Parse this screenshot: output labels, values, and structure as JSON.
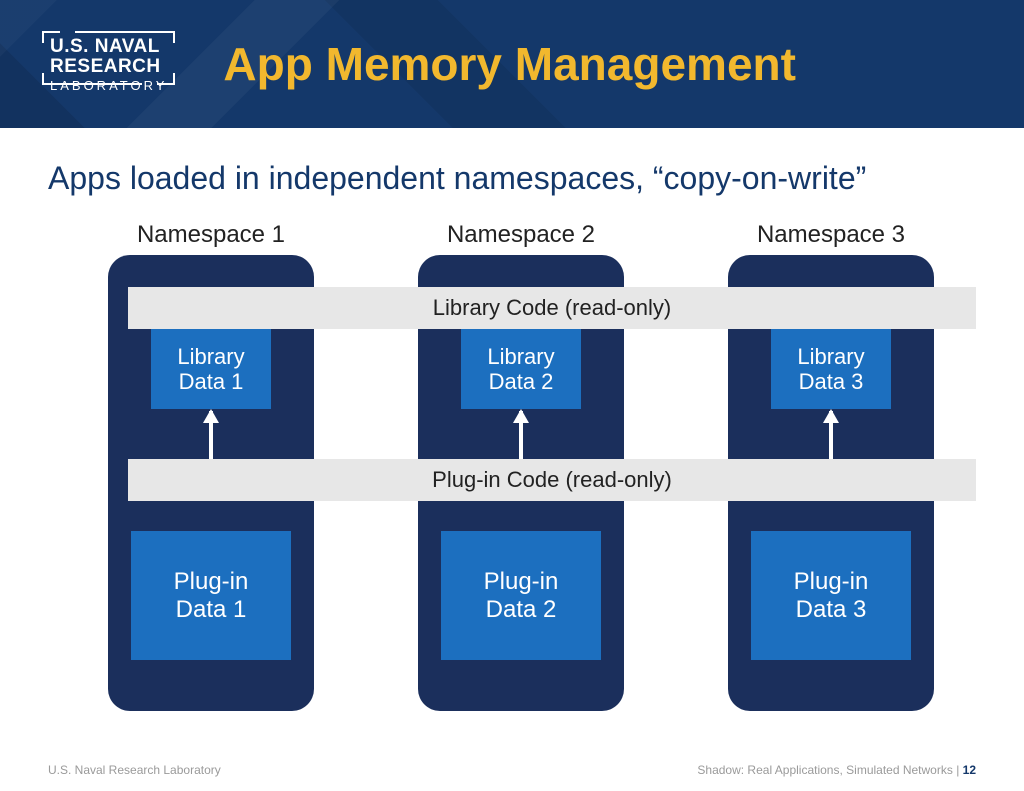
{
  "header": {
    "logo_l1": "U.S. NAVAL",
    "logo_l2": "RESEARCH",
    "logo_l3": "LABORATORY",
    "title": "App Memory Management"
  },
  "subtitle": "Apps loaded in independent namespaces, “copy-on-write”",
  "namespaces": [
    {
      "label": "Namespace 1",
      "lib": "Library\nData 1",
      "plug": "Plug-in\nData 1"
    },
    {
      "label": "Namespace 2",
      "lib": "Library\nData 2",
      "plug": "Plug-in\nData 2"
    },
    {
      "label": "Namespace 3",
      "lib": "Library\nData 3",
      "plug": "Plug-in\nData 3"
    }
  ],
  "bands": {
    "library": "Library Code (read-only)",
    "plugin": "Plug-in Code (read-only)"
  },
  "footer": {
    "left": "U.S. Naval Research Laboratory",
    "right_prefix": "Shadow: Real Applications, Simulated Networks |  ",
    "page": "12"
  }
}
